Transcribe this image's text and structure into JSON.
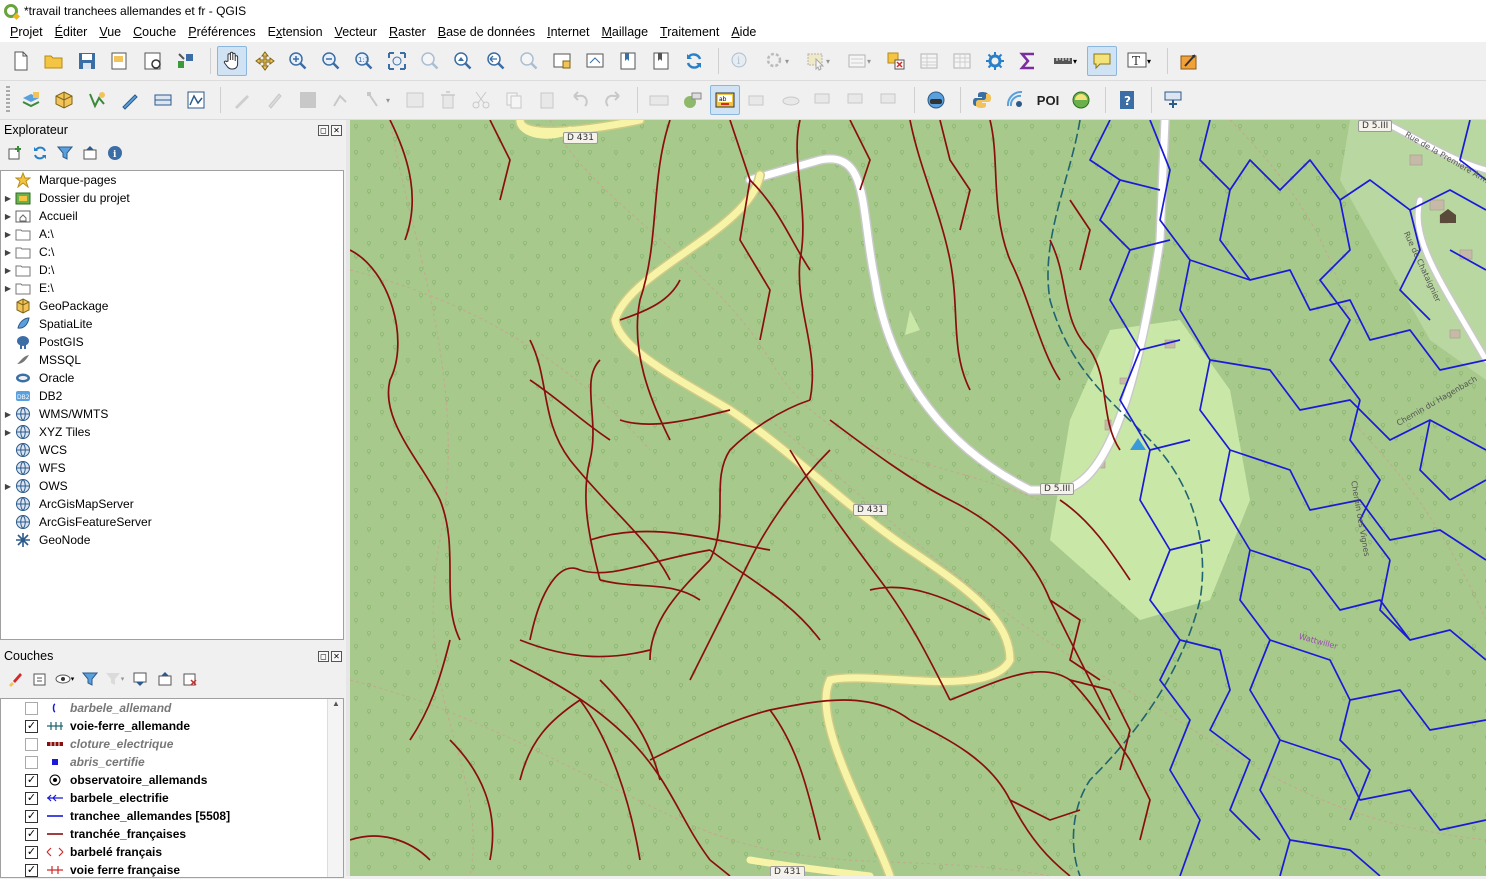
{
  "window": {
    "title": "*travail tranchees allemandes et fr - QGIS"
  },
  "menu": [
    {
      "label": "Projet",
      "key": "P"
    },
    {
      "label": "Éditer",
      "key": "É"
    },
    {
      "label": "Vue",
      "key": "V"
    },
    {
      "label": "Couche",
      "key": "C"
    },
    {
      "label": "Préférences",
      "key": "P"
    },
    {
      "label": "Extension",
      "key": "x"
    },
    {
      "label": "Vecteur",
      "key": "V"
    },
    {
      "label": "Raster",
      "key": "R"
    },
    {
      "label": "Base de données",
      "key": "B"
    },
    {
      "label": "Internet",
      "key": "I"
    },
    {
      "label": "Maillage",
      "key": "M"
    },
    {
      "label": "Traitement",
      "key": "T"
    },
    {
      "label": "Aide",
      "key": "A"
    }
  ],
  "toolbar2": {
    "poi_label": "POI"
  },
  "explorer": {
    "title": "Explorateur",
    "items": [
      {
        "label": "Marque-pages",
        "expand": false,
        "icon": "star-icon"
      },
      {
        "label": "Dossier du projet",
        "expand": true,
        "icon": "project-folder-icon"
      },
      {
        "label": "Accueil",
        "expand": true,
        "icon": "home-folder-icon"
      },
      {
        "label": "A:\\",
        "expand": true,
        "icon": "folder-icon"
      },
      {
        "label": "C:\\",
        "expand": true,
        "icon": "folder-icon"
      },
      {
        "label": "D:\\",
        "expand": true,
        "icon": "folder-icon"
      },
      {
        "label": "E:\\",
        "expand": true,
        "icon": "folder-icon"
      },
      {
        "label": "GeoPackage",
        "expand": false,
        "icon": "geopackage-icon"
      },
      {
        "label": "SpatiaLite",
        "expand": false,
        "icon": "spatialite-icon"
      },
      {
        "label": "PostGIS",
        "expand": false,
        "icon": "postgis-icon"
      },
      {
        "label": "MSSQL",
        "expand": false,
        "icon": "mssql-icon"
      },
      {
        "label": "Oracle",
        "expand": false,
        "icon": "oracle-icon"
      },
      {
        "label": "DB2",
        "expand": false,
        "icon": "db2-icon"
      },
      {
        "label": "WMS/WMTS",
        "expand": true,
        "icon": "globe-icon"
      },
      {
        "label": "XYZ Tiles",
        "expand": true,
        "icon": "globe-icon"
      },
      {
        "label": "WCS",
        "expand": false,
        "icon": "globe-icon"
      },
      {
        "label": "WFS",
        "expand": false,
        "icon": "globe-icon"
      },
      {
        "label": "OWS",
        "expand": true,
        "icon": "globe-icon"
      },
      {
        "label": "ArcGisMapServer",
        "expand": false,
        "icon": "globe-icon"
      },
      {
        "label": "ArcGisFeatureServer",
        "expand": false,
        "icon": "globe-icon"
      },
      {
        "label": "GeoNode",
        "expand": false,
        "icon": "geonode-icon"
      }
    ]
  },
  "layers": {
    "title": "Couches",
    "items": [
      {
        "label": "barbele_allemand",
        "checked": false,
        "symbol": "dot-blue"
      },
      {
        "label": "voie-ferre_allemande",
        "checked": true,
        "symbol": "rail-blue"
      },
      {
        "label": "cloture_electrique",
        "checked": false,
        "symbol": "fence-red"
      },
      {
        "label": "abris_certifie",
        "checked": false,
        "symbol": "square-blue"
      },
      {
        "label": "observatoire_allemands",
        "checked": true,
        "symbol": "target-black"
      },
      {
        "label": "barbele_electrifie",
        "checked": true,
        "symbol": "arrow-blue"
      },
      {
        "label": "tranchee_allemandes [5508]",
        "checked": true,
        "symbol": "line-blue"
      },
      {
        "label": "tranchée_françaises",
        "checked": true,
        "symbol": "line-red"
      },
      {
        "label": "barbelé français",
        "checked": true,
        "symbol": "cross-red"
      },
      {
        "label": "voie ferre française",
        "checked": true,
        "symbol": "rail-red"
      }
    ]
  },
  "map": {
    "labels": [
      {
        "text": "D 431"
      },
      {
        "text": "D 431"
      },
      {
        "text": "D 431"
      },
      {
        "text": "D 5.III"
      },
      {
        "text": "D 5.III"
      },
      {
        "text": "Rue de la Première Armée"
      },
      {
        "text": "Rue de Chataignier"
      },
      {
        "text": "Chemin du Hagenbach"
      },
      {
        "text": "Chemin des Vignes"
      },
      {
        "text": "Wattwiller"
      }
    ],
    "colors": {
      "forest": "#a7c98c",
      "meadow": "#d3efb0",
      "french_trench": "#8b0e0e",
      "german_trench": "#1a1ad8",
      "road_yellow": "#f7f4a8",
      "road_white": "#ffffff",
      "german_rail": "#1f6470"
    }
  }
}
